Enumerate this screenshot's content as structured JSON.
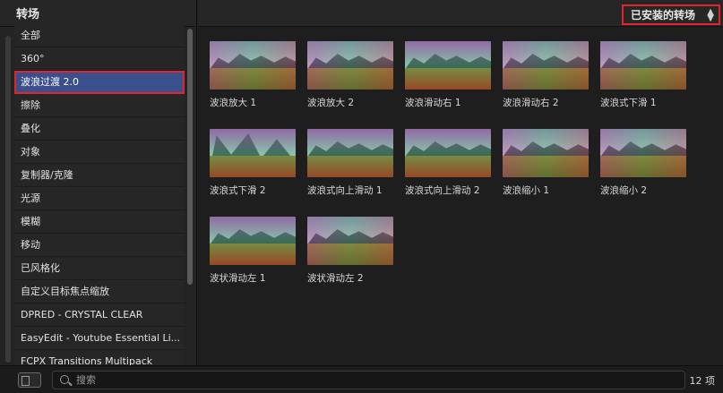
{
  "sidebar": {
    "title": "转场",
    "items": [
      {
        "label": "全部"
      },
      {
        "label": "360°"
      },
      {
        "label": "波浪过渡 2.0",
        "selected": true
      },
      {
        "label": "擦除"
      },
      {
        "label": "叠化"
      },
      {
        "label": "对象"
      },
      {
        "label": "复制器/克隆"
      },
      {
        "label": "光源"
      },
      {
        "label": "模糊"
      },
      {
        "label": "移动"
      },
      {
        "label": "已风格化"
      },
      {
        "label": "自定义目标焦点缩放"
      },
      {
        "label": "DPRED - CRYSTAL CLEAR"
      },
      {
        "label": "EasyEdit - Youtube Essential Li..."
      },
      {
        "label": "FCPX Transitions Multipack"
      }
    ]
  },
  "header": {
    "filter_label": "已安装的转场"
  },
  "transitions": [
    {
      "label": "波浪放大 1"
    },
    {
      "label": "波浪放大 2"
    },
    {
      "label": "波浪滑动右 1"
    },
    {
      "label": "波浪滑动右 2"
    },
    {
      "label": "波浪式下滑 1"
    },
    {
      "label": "波浪式下滑 2"
    },
    {
      "label": "波浪式向上滑动 1"
    },
    {
      "label": "波浪式向上滑动 2"
    },
    {
      "label": "波浪缩小 1"
    },
    {
      "label": "波浪缩小 2"
    },
    {
      "label": "波状滑动左 1"
    },
    {
      "label": "波状滑动左 2"
    }
  ],
  "bottom": {
    "search_placeholder": "搜索",
    "count": "12 项"
  }
}
